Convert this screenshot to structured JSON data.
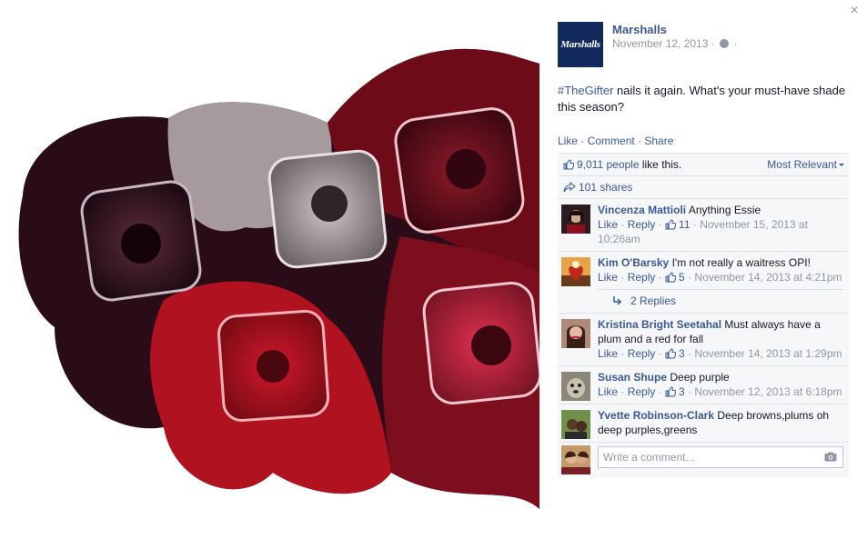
{
  "photo": {
    "alt": ""
  },
  "close_glyph": "×",
  "page": {
    "name": "Marshalls",
    "logo_text": "Marshalls",
    "date": "November 12, 2013",
    "meta_dot": "·"
  },
  "post": {
    "hashtag": "#TheGifter",
    "text": " nails it again. What's your must-have shade this season?"
  },
  "actions": {
    "like": "Like",
    "comment": "Comment",
    "share": "Share",
    "sep": " · "
  },
  "ufi": {
    "likes_count": "9,011 people",
    "likes_suffix": " like this.",
    "sort_label": "Most Relevant",
    "shares": "101 shares"
  },
  "comments": [
    {
      "author": "Vincenza Mattioli",
      "text": " Anything Essie",
      "like": "Like",
      "reply": "Reply",
      "likes": "11",
      "time": "November 15, 2013 at 10:26am",
      "avatar_color": "#5a2a2f"
    },
    {
      "author": "Kim O'Barsky",
      "text": " I'm not really a waitress OPI!",
      "like": "Like",
      "reply": "Reply",
      "likes": "5",
      "time": "November 14, 2013 at 4:21pm",
      "avatar_color": "#c84a1e"
    },
    {
      "author": "Kristina Bright Seetahal",
      "text": " Must always have a plum and a red for fall",
      "like": "Like",
      "reply": "Reply",
      "likes": "3",
      "time": "November 14, 2013 at 1:29pm",
      "avatar_color": "#8a5a4a"
    },
    {
      "author": "Susan Shupe",
      "text": " Deep purple",
      "like": "Like",
      "reply": "Reply",
      "likes": "3",
      "time": "November 12, 2013 at 6:18pm",
      "avatar_color": "#7a7468"
    },
    {
      "author": "Yvette Robinson-Clark",
      "text": " Deep browns,plums oh deep purples,greens",
      "avatar_color": "#4f6a3a"
    }
  ],
  "replies_link": "2 Replies",
  "write_placeholder": "Write a comment...",
  "colors": {
    "link": "#3b5998",
    "meta": "#9197a3",
    "panel": "#f6f7f9",
    "brand": "#12295c"
  }
}
